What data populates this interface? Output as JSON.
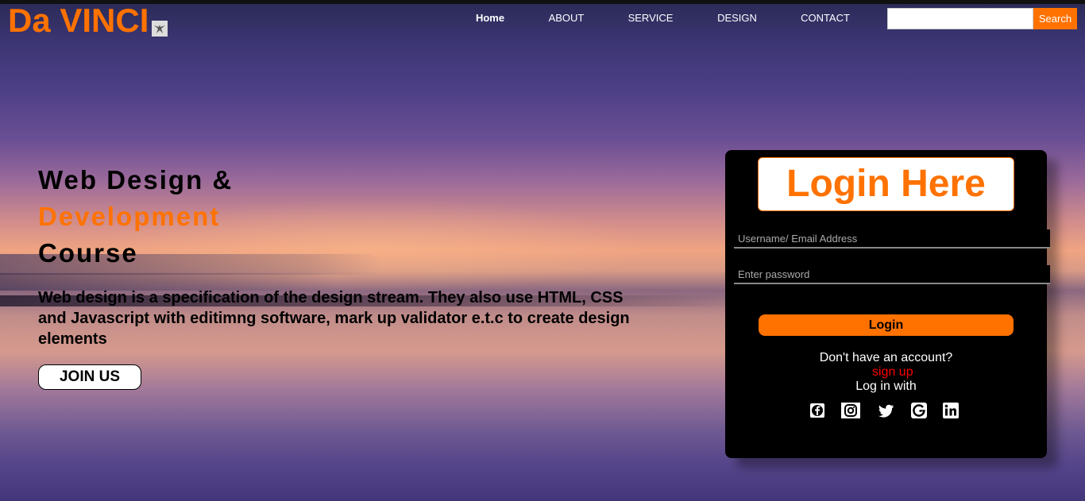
{
  "header": {
    "logo": "Da VINCI",
    "nav": [
      "Home",
      "ABOUT",
      "SERVICE",
      "DESIGN",
      "CONTACT"
    ],
    "search_placeholder": "",
    "search_button": "Search"
  },
  "hero": {
    "line1": "Web Design &",
    "line2": "Development",
    "line3": "Course",
    "description": "Web design is a specification of the design stream. They also use HTML, CSS and Javascript with editimng software, mark up validator e.t.c to create design elements",
    "cta": "JOIN US"
  },
  "login": {
    "title": "Login Here",
    "username_placeholder": "Username/ Email Address",
    "password_placeholder": "Enter password",
    "button": "Login",
    "no_account": "Don't have an account?",
    "signup": "sign up",
    "log_in_with": "Log in with",
    "social_icons": [
      "facebook-icon",
      "instagram-icon",
      "twitter-icon",
      "google-icon",
      "linkedin-icon"
    ]
  },
  "colors": {
    "accent": "#ff7200",
    "card": "#000000",
    "signup": "#ff0000"
  }
}
